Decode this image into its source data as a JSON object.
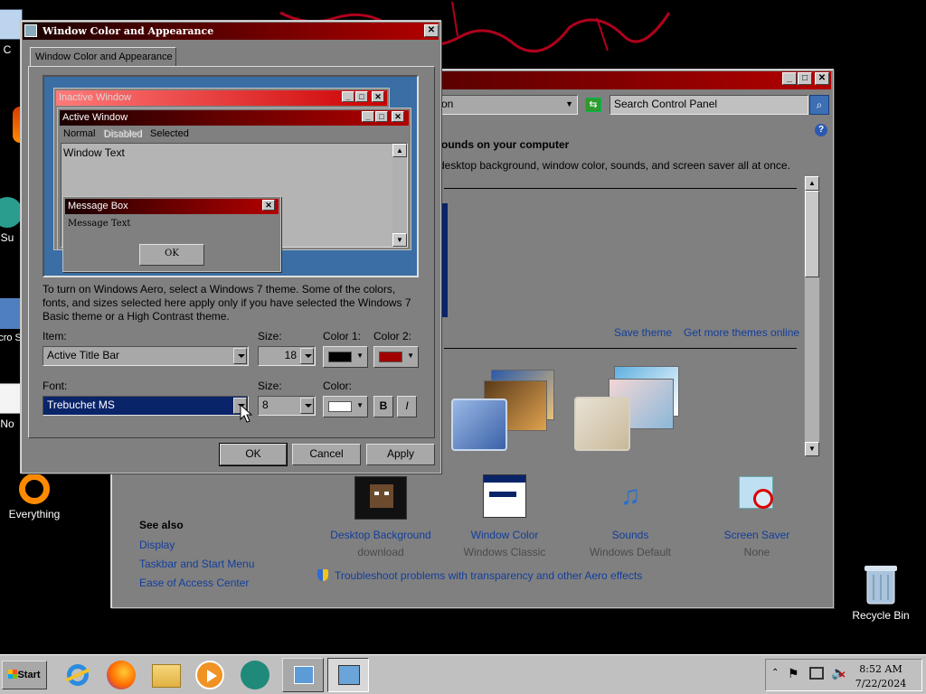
{
  "desktop": {
    "icons": [
      {
        "label": "C",
        "name": "computer-icon"
      },
      {
        "label": "Su",
        "name": "support-icon"
      },
      {
        "label": "Micro Sti",
        "name": "micro-sti-icon"
      },
      {
        "label": "No",
        "name": "notes-icon"
      },
      {
        "label": "Everything",
        "name": "everything-icon"
      },
      {
        "label": "Recycle Bin",
        "name": "recycle-bin-icon"
      }
    ]
  },
  "control_panel": {
    "address_tail": "on",
    "search_placeholder": "Search Control Panel",
    "heading": "ounds on your computer",
    "subheading": "desktop background, window color, sounds, and screen saver all at once.",
    "save_theme": "Save theme",
    "get_more_themes": "Get more themes online",
    "bottom_items": [
      {
        "title": "Desktop Background",
        "sub": "download"
      },
      {
        "title": "Window Color",
        "sub": "Windows Classic"
      },
      {
        "title": "Sounds",
        "sub": "Windows Default"
      },
      {
        "title": "Screen Saver",
        "sub": "None"
      }
    ],
    "see_also": "See also",
    "see_also_links": [
      "Display",
      "Taskbar and Start Menu",
      "Ease of Access Center"
    ],
    "troubleshoot": "Troubleshoot problems with transparency and other Aero effects"
  },
  "dialog": {
    "title": "Window Color and Appearance",
    "tab": "Window Color and Appearance",
    "preview": {
      "inactive": "Inactive Window",
      "active": "Active Window",
      "menu": [
        "Normal",
        "Disabled",
        "Selected"
      ],
      "window_text": "Window Text",
      "msgbox_title": "Message Box",
      "msgbox_text": "Message Text",
      "msgbox_ok": "OK"
    },
    "info": "To turn on Windows Aero, select a Windows 7 theme.  Some of the colors, fonts, and sizes selected here apply only if you have selected the Windows 7 Basic theme or a High Contrast theme.",
    "item_label": "Item:",
    "item_value": "Active Title Bar",
    "size_label": "Size:",
    "item_size": "18",
    "color1_label": "Color 1:",
    "color2_label": "Color 2:",
    "color1": "#000000",
    "color2": "#a00000",
    "font_label": "Font:",
    "font_value": "Trebuchet MS",
    "font_size_label": "Size:",
    "font_size": "8",
    "font_color_label": "Color:",
    "font_color": "#ffffff",
    "bold": "B",
    "italic": "I",
    "ok": "OK",
    "cancel": "Cancel",
    "apply": "Apply"
  },
  "taskbar": {
    "start": "Start",
    "time": "8:52 AM",
    "date": "7/22/2024"
  }
}
